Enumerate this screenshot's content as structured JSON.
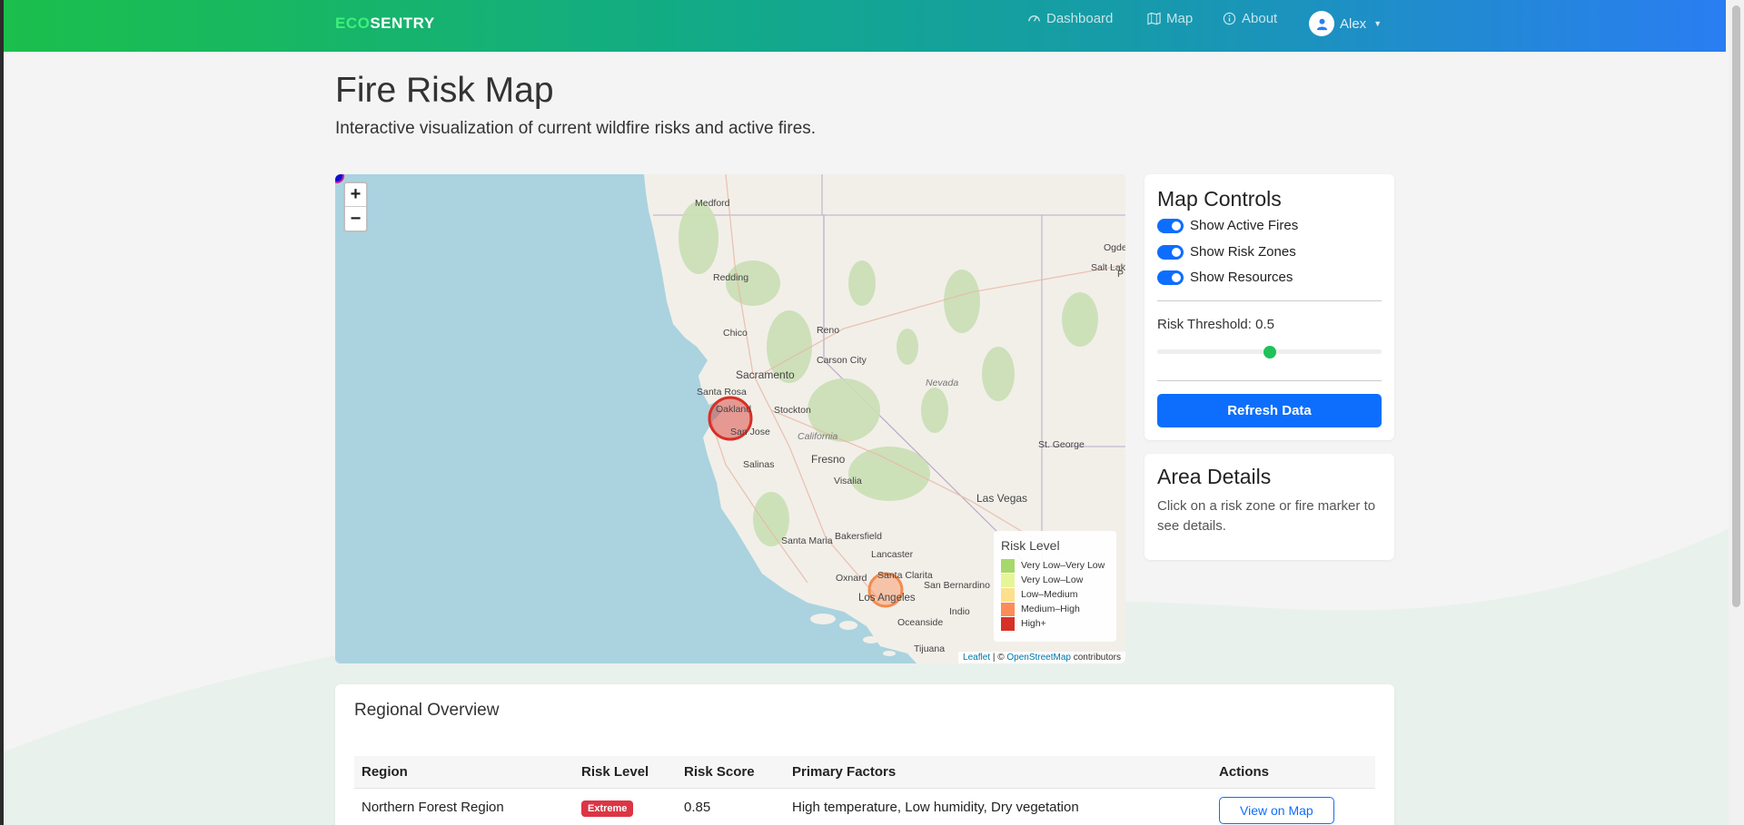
{
  "navbar": {
    "brand_eco": "ECO",
    "brand_sentry": "SENTRY",
    "links": [
      {
        "label": "Dashboard",
        "icon": "gauge-icon"
      },
      {
        "label": "Map",
        "icon": "map-icon"
      },
      {
        "label": "About",
        "icon": "info-icon"
      }
    ],
    "user": {
      "name": "Alex",
      "icon": "user-icon"
    }
  },
  "page": {
    "title": "Fire Risk Map",
    "subtitle": "Interactive visualization of current wildfire risks and active fires."
  },
  "map": {
    "zoom_in": "+",
    "zoom_out": "−",
    "places": [
      "Medford",
      "Redding",
      "Chico",
      "Reno",
      "Carson City",
      "Sacramento",
      "Santa Rosa",
      "Oakland",
      "San Jose",
      "Stockton",
      "California",
      "Fresno",
      "Salinas",
      "Visalia",
      "Nevada",
      "St. George",
      "Las Vegas",
      "Bakersfield",
      "Santa Maria",
      "Lancaster",
      "Oxnard",
      "Santa Clarita",
      "Los Angeles",
      "San Bernardino",
      "Indio",
      "Oceanside",
      "Tijuana",
      "Ogde",
      "Salt Lak",
      "P"
    ],
    "legend": {
      "title": "Risk Level",
      "items": [
        {
          "label": "Very Low–Very Low",
          "color": "#a6d96a"
        },
        {
          "label": "Very Low–Low",
          "color": "#e6f598"
        },
        {
          "label": "Low–Medium",
          "color": "#fee08b"
        },
        {
          "label": "Medium–High",
          "color": "#fc8d59"
        },
        {
          "label": "High+",
          "color": "#d73027"
        }
      ]
    },
    "attribution": {
      "leaflet": "Leaflet",
      "sep": " | © ",
      "osm": "OpenStreetMap",
      "suffix": " contributors"
    }
  },
  "controls": {
    "title": "Map Controls",
    "toggles": [
      {
        "label": "Show Active Fires",
        "checked": true
      },
      {
        "label": "Show Risk Zones",
        "checked": true
      },
      {
        "label": "Show Resources",
        "checked": true
      }
    ],
    "threshold_label": "Risk Threshold: 0.5",
    "threshold_value": 0.5,
    "refresh_label": "Refresh Data"
  },
  "details": {
    "title": "Area Details",
    "text": "Click on a risk zone or fire marker to see details."
  },
  "overview": {
    "title": "Regional Overview",
    "columns": [
      "Region",
      "Risk Level",
      "Risk Score",
      "Primary Factors",
      "Actions"
    ],
    "rows": [
      {
        "region": "Northern Forest Region",
        "risk_level": "Extreme",
        "risk_score": "0.85",
        "factors": "High temperature, Low humidity, Dry vegetation",
        "action": "View on Map"
      }
    ]
  },
  "colors": {
    "primary": "#0d6efd",
    "success": "#1ec15a",
    "danger": "#dc3545",
    "water": "#aad3df",
    "land": "#f2efe9"
  }
}
